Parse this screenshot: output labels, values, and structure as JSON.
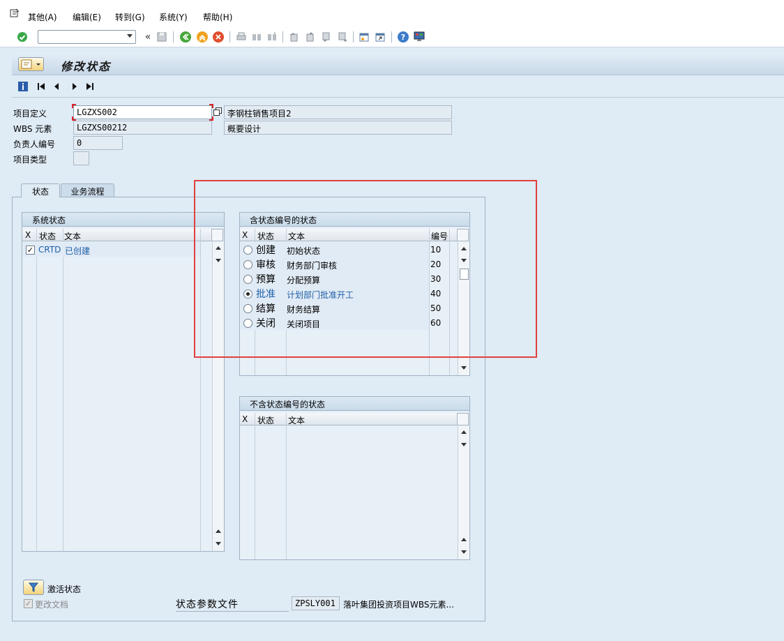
{
  "menu": {
    "items": [
      "其他(A)",
      "编辑(E)",
      "转到(G)",
      "系统(Y)",
      "帮助(H)"
    ]
  },
  "toolbar": {
    "command_value": "",
    "icons": [
      "enter-icon",
      "back-icon",
      "exit-icon",
      "cancel-icon",
      "save-icon",
      "print-icon",
      "find-icon",
      "find-next-icon",
      "first-page-icon",
      "prev-page-icon",
      "next-page-icon",
      "last-page-icon",
      "new-session-icon",
      "shortcut-icon",
      "help-icon",
      "layout-icon"
    ]
  },
  "title": {
    "text": "修改状态"
  },
  "header": {
    "project_def_label": "项目定义",
    "project_def_value": "LGZXS002",
    "project_def_desc": "李钢柱销售项目2",
    "wbs_label": "WBS 元素",
    "wbs_value": "LGZXS00212",
    "wbs_desc": "概要设计",
    "responsible_label": "负责人编号",
    "responsible_value": "0",
    "project_type_label": "项目类型",
    "project_type_value": ""
  },
  "tabs": {
    "status": "状态",
    "workflow": "业务流程"
  },
  "system_status": {
    "title": "系统状态",
    "col_x": "X",
    "col_status": "状态",
    "col_text": "文本",
    "rows": [
      {
        "checked": true,
        "status": "CRTD",
        "text": "已创建"
      }
    ]
  },
  "numbered_status": {
    "title": "含状态编号的状态",
    "col_x": "X",
    "col_status": "状态",
    "col_text": "文本",
    "col_no": "编号",
    "rows": [
      {
        "selected": false,
        "status": "创建",
        "text": "初始状态",
        "no": "10"
      },
      {
        "selected": false,
        "status": "审核",
        "text": "财务部门审核",
        "no": "20"
      },
      {
        "selected": false,
        "status": "预算",
        "text": "分配预算",
        "no": "30"
      },
      {
        "selected": true,
        "status": "批准",
        "text": "计划部门批准开工",
        "no": "40"
      },
      {
        "selected": false,
        "status": "结算",
        "text": "财务结算",
        "no": "50"
      },
      {
        "selected": false,
        "status": "关闭",
        "text": "关闭项目",
        "no": "60"
      }
    ]
  },
  "unnumbered_status": {
    "title": "不含状态编号的状态",
    "col_x": "X",
    "col_status": "状态",
    "col_text": "文本"
  },
  "footer": {
    "activate_label": "激活状态",
    "change_docs_label": "更改文档",
    "change_docs_checked": true,
    "profile_label": "状态参数文件",
    "profile_value": "ZPSLY001",
    "profile_desc": "落叶集团投资项目WBS元素..."
  },
  "colors": {
    "background": "#dfebf5",
    "highlight": "#e04040",
    "link_blue": "#1f5fa8"
  }
}
